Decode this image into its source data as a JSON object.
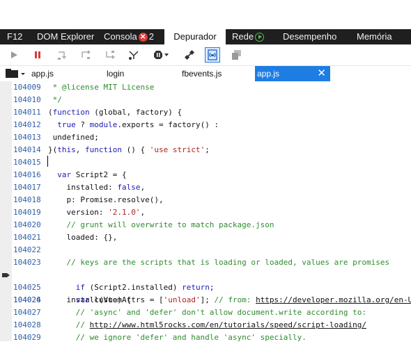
{
  "devtools": {
    "tabs": [
      {
        "label": "F12"
      },
      {
        "label": "DOM Explorer"
      },
      {
        "label": "Consola",
        "badge": "2"
      },
      {
        "label": "Depurador"
      },
      {
        "label": "Rede"
      },
      {
        "label": "Desempenho"
      },
      {
        "label": "Memória"
      }
    ]
  },
  "file_tabs": [
    "app.js",
    "login",
    "fbevents.js",
    "app.js"
  ],
  "code_lines": [
    {
      "num": "104009"
    },
    {
      "num": "104010"
    },
    {
      "num": "104011"
    },
    {
      "num": "104012"
    },
    {
      "num": "104013"
    },
    {
      "num": "104014"
    },
    {
      "num": "104015"
    },
    {
      "num": "104016"
    },
    {
      "num": "104017"
    },
    {
      "num": "104018"
    },
    {
      "num": "104019"
    },
    {
      "num": "104020"
    },
    {
      "num": "104021"
    },
    {
      "num": "104022"
    },
    {
      "num": "104023"
    },
    {
      "num": "104024"
    },
    {
      "num": "104025"
    },
    {
      "num": "104026"
    },
    {
      "num": "104027"
    },
    {
      "num": "104028"
    },
    {
      "num": "104029"
    }
  ],
  "code": {
    "l0": " * @license MIT License",
    "l1": " */",
    "l2a": "(",
    "l2b": "function",
    "l2c": " (global, factory) {",
    "l3a": "  ",
    "l3b": "true",
    "l3c": " ? ",
    "l3d": "module",
    "l3e": ".exports = factory() :",
    "l4": " undefined;",
    "l5a": "}(",
    "l5b": "this",
    "l5c": ", ",
    "l5d": "function",
    "l5e": " () { ",
    "l5f": "'use strict'",
    "l5g": ";",
    "l7a": "  ",
    "l7b": "var",
    "l7c": " Script2 = {",
    "l8a": "    installed: ",
    "l8b": "false",
    "l8c": ",",
    "l9": "    p: Promise.resolve(),",
    "l10a": "    version: ",
    "l10b": "'2.1.0'",
    "l10c": ",",
    "l11": "    // grunt will overwrite to match package.json",
    "l12": "    loaded: {},",
    "l14": "    // keys are the scripts that is loading or loaded, values are promises",
    "l15": "    install(Vue) {",
    "l16a": "      ",
    "l16b": "if",
    "l16c": " (Script2.installed) ",
    "l16d": "return",
    "l16e": ";",
    "l17a": "      ",
    "l17b": "var",
    "l17c": " customAttrs = [",
    "l17d": "'unload'",
    "l17e": "]; ",
    "l17f": "// from: ",
    "l17g": "https://developer.mozilla.org/en-U",
    "l18": "      // 'async' and 'defer' don't allow document.write according to:",
    "l19a": "      // ",
    "l19b": "http://www.html5rocks.com/en/tutorials/speed/script-loading/",
    "l20": "      // we ignore 'defer' and handle 'async' specially."
  }
}
